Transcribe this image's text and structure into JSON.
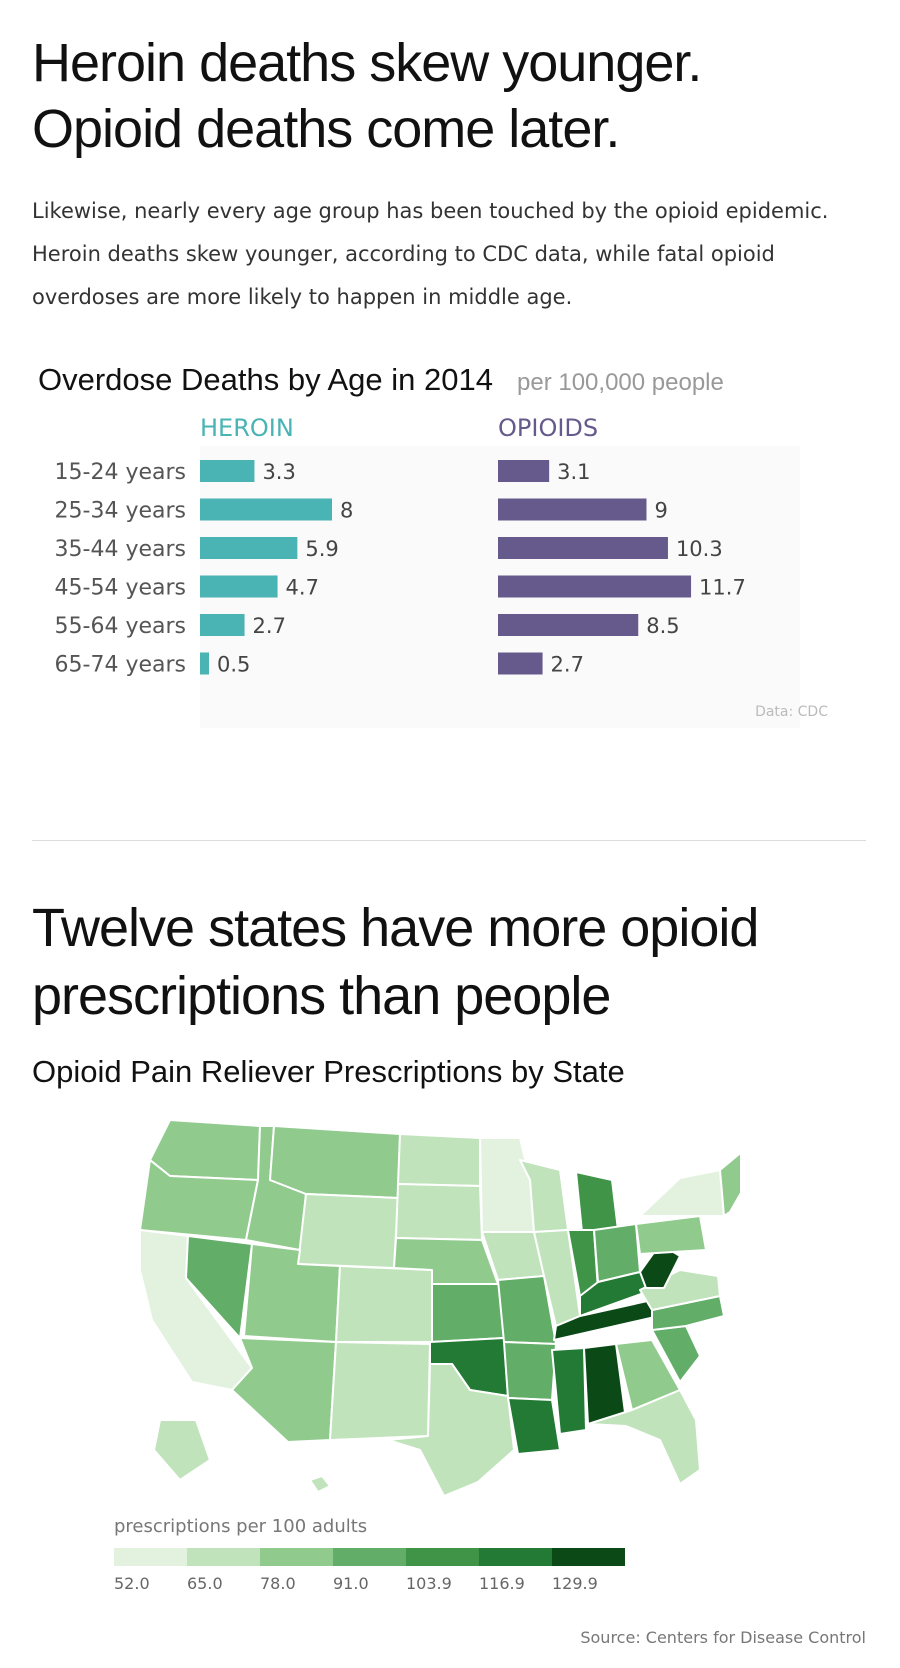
{
  "headline1": [
    "Heroin deaths skew younger.",
    "Opioid deaths come later."
  ],
  "intro": "Likewise, nearly every age group has been touched by the opioid epidemic. Heroin deaths skew younger, according to CDC data, while fatal opioid overdoses are more likely to happen in middle age.",
  "headline2": [
    "Twelve states have more opioid",
    "prescriptions than people"
  ],
  "source": "Source: Centers for Disease Control",
  "chart_data": [
    {
      "type": "bar",
      "orientation": "horizontal",
      "title": "Overdose Deaths by Age in 2014",
      "subtitle": "per 100,000 people",
      "categories": [
        "15-24 years",
        "25-34 years",
        "35-44 years",
        "45-54 years",
        "55-64 years",
        "65-74 years"
      ],
      "series": [
        {
          "name": "HEROIN",
          "color": "#4ab3b3",
          "values": [
            3.3,
            8,
            5.9,
            4.7,
            2.7,
            0.5
          ]
        },
        {
          "name": "OPIOIDS",
          "color": "#66598c",
          "values": [
            3.1,
            9,
            10.3,
            11.7,
            8.5,
            2.7
          ]
        }
      ],
      "note": "Data: CDC",
      "xlim": [
        0,
        12
      ]
    },
    {
      "type": "heatmap",
      "subtype": "choropleth",
      "title": "Opioid Pain Reliever Prescriptions by State",
      "legend_title": "prescriptions per 100 adults",
      "legend_ticks": [
        "52.0",
        "65.0",
        "78.0",
        "91.0",
        "103.9",
        "116.9",
        "129.9"
      ],
      "legend_colors": [
        "#e2f2df",
        "#c0e3bb",
        "#90ca8d",
        "#62ad68",
        "#3f9448",
        "#237a35",
        "#0b4a16"
      ]
    }
  ]
}
